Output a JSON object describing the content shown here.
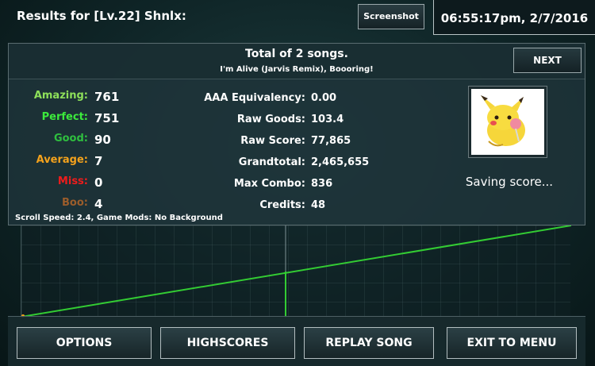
{
  "header": {
    "title": "Results for [Lv.22] Shnlx:",
    "screenshot_label": "Screenshot",
    "clock": "06:55:17pm, 2/7/2016"
  },
  "summary": {
    "total": "Total of 2 songs.",
    "songs": "I'm Alive (Jarvis Remix), Boooring!",
    "next_label": "NEXT"
  },
  "judgements": [
    {
      "label": "Amazing:",
      "value": "761",
      "color": "#8ee05a"
    },
    {
      "label": "Perfect:",
      "value": "751",
      "color": "#3cea3c"
    },
    {
      "label": "Good:",
      "value": "90",
      "color": "#2fbf3f"
    },
    {
      "label": "Average:",
      "value": "7",
      "color": "#f4a21c"
    },
    {
      "label": "Miss:",
      "value": "0",
      "color": "#ee1c1c"
    },
    {
      "label": "Boo:",
      "value": "4",
      "color": "#9b5d2b"
    }
  ],
  "stats": [
    {
      "label": "AAA Equivalency:",
      "value": "0.00"
    },
    {
      "label": "Raw Goods:",
      "value": "103.4"
    },
    {
      "label": "Raw Score:",
      "value": "77,865"
    },
    {
      "label": "Grandtotal:",
      "value": "2,465,655"
    },
    {
      "label": "Max Combo:",
      "value": "836"
    },
    {
      "label": "Credits:",
      "value": "48"
    }
  ],
  "mods": "Scroll Speed: 2.4, Game Mods: No Background",
  "saving": "Saving score...",
  "avatar_icon": "pikachu-avatar",
  "graph": {
    "line_color": "#33cc33",
    "song_split_fraction": 0.48
  },
  "buttons": {
    "options": "OPTIONS",
    "highscores": "HIGHSCORES",
    "replay": "REPLAY SONG",
    "exit": "EXIT TO MENU"
  }
}
